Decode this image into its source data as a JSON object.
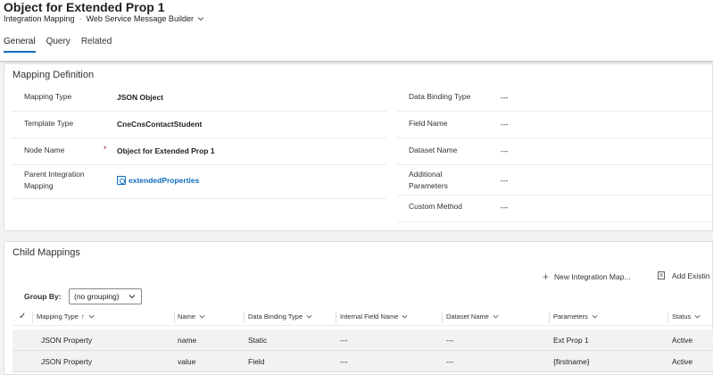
{
  "header": {
    "title": "Object for Extended Prop 1",
    "entity": "Integration Mapping",
    "separator": "·",
    "form": "Web Service Message Builder"
  },
  "tabs": [
    {
      "label": "General",
      "active": true
    },
    {
      "label": "Query",
      "active": false
    },
    {
      "label": "Related",
      "active": false
    }
  ],
  "mapping_definition": {
    "title": "Mapping Definition",
    "left_fields": [
      {
        "label": "Mapping Type",
        "value": "JSON Object"
      },
      {
        "label": "Template Type",
        "value": "CneCnsContactStudent"
      },
      {
        "label": "Node Name",
        "value": "Object for Extended Prop 1",
        "required_marker": "*"
      },
      {
        "label": "Parent Integration Mapping",
        "value": "extendedProperties"
      }
    ],
    "right_fields": [
      {
        "label": "Data Binding Type",
        "value": "---"
      },
      {
        "label": "Field Name",
        "value": "---"
      },
      {
        "label": "Dataset Name",
        "value": "---"
      },
      {
        "label": "Additional Parameters",
        "value": "---"
      },
      {
        "label": "Custom Method",
        "value": "---"
      }
    ]
  },
  "child_mappings": {
    "title": "Child Mappings",
    "commands": {
      "new_label": "New Integration Map...",
      "add_existing_label": "Add Existin"
    },
    "group_by": {
      "label": "Group By:",
      "selected": "(no grouping)"
    },
    "columns": [
      "Mapping Type",
      "Name",
      "Data Binding Type",
      "Internal Field Name",
      "Dataset Name",
      "Parameters",
      "Status"
    ],
    "rows": [
      [
        "JSON Property",
        "name",
        "Static",
        "---",
        "---",
        "Ext Prop 1",
        "Active"
      ],
      [
        "JSON Property",
        "value",
        "Field",
        "---",
        "---",
        "{firstname}",
        "Active"
      ]
    ]
  },
  "icons": {
    "link": "lookup-record-icon",
    "new": "plus-icon",
    "add_existing": "add-existing-icon",
    "select_all": "checkmark-icon",
    "sort": "sort-ascending-icon",
    "filter": "chevron-down-icon"
  },
  "colors": {
    "accent": "#0f6cbd",
    "required": "#a4262c"
  }
}
